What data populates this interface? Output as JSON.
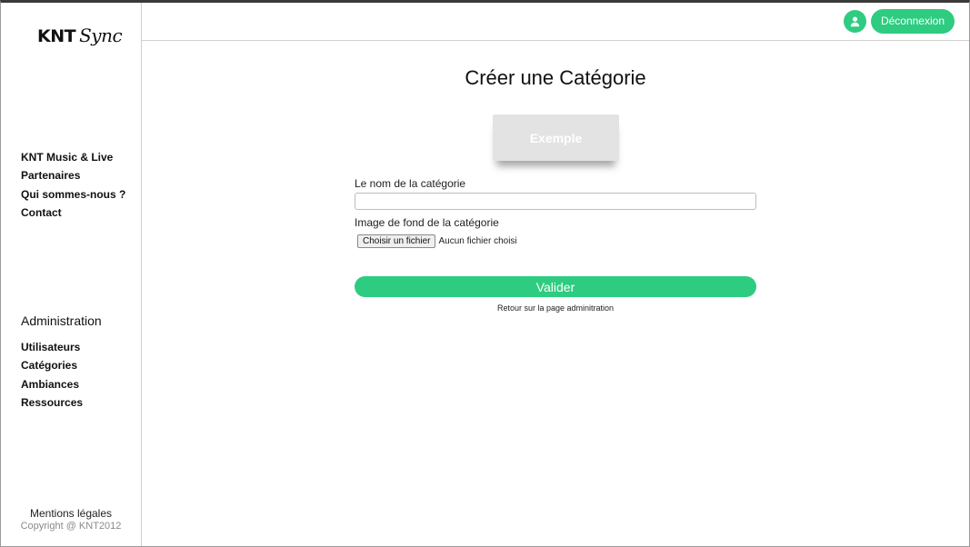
{
  "brand": {
    "name": "KNT",
    "script": "Sync"
  },
  "sidebar": {
    "nav_items": [
      {
        "label": "KNT Music & Live"
      },
      {
        "label": "Partenaires"
      },
      {
        "label": "Qui sommes-nous ?"
      },
      {
        "label": "Contact"
      }
    ],
    "admin_title": "Administration",
    "admin_items": [
      {
        "label": "Utilisateurs"
      },
      {
        "label": "Catégories"
      },
      {
        "label": "Ambiances"
      },
      {
        "label": "Ressources"
      }
    ],
    "footer": {
      "mentions": "Mentions légales",
      "copyright": "Copyright @ KNT2012"
    }
  },
  "topbar": {
    "user_icon": "user-icon",
    "logout_label": "Déconnexion"
  },
  "main": {
    "title": "Créer une Catégorie",
    "preview_label": "Exemple",
    "name_label": "Le nom de la catégorie",
    "name_value": "",
    "image_label": "Image de fond de la catégorie",
    "file_button": "Choisir un fichier",
    "file_status": "Aucun fichier choisi",
    "submit_label": "Valider",
    "back_link": "Retour sur la page adminitration"
  },
  "colors": {
    "accent": "#2ecc80",
    "preview_bg": "#e3e3e3"
  }
}
